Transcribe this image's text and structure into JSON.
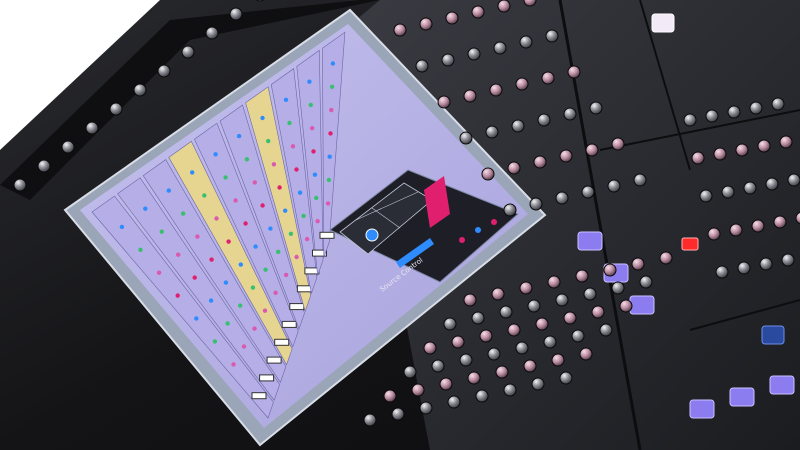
{
  "screen": {
    "overlay_label": "Source Control",
    "channel_buttons": [
      "",
      ""
    ]
  },
  "colors": {
    "background": "#ffffff",
    "console_body": "#141416",
    "panel": "#1e1f23",
    "screen_bezel": "#9aa6b8",
    "strip_lilac": "#b6aee6",
    "strip_yellow": "#e6d590",
    "accent_pink": "#e0206f",
    "accent_blue": "#2f8cff",
    "button_purple": "#8b7cf0",
    "led_red": "#ff2a2a"
  }
}
